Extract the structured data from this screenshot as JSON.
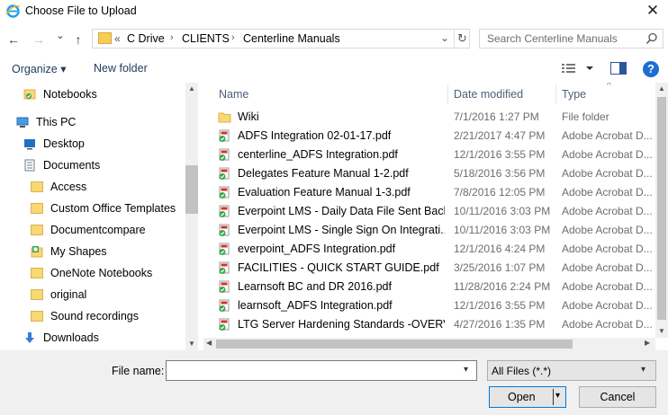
{
  "window": {
    "title": "Choose File to Upload",
    "close_glyph": "✕"
  },
  "navigation": {
    "back_glyph": "←",
    "forward_glyph": "→",
    "recent_glyph": "⌄",
    "up_glyph": "↑"
  },
  "address": {
    "chevrons": "«",
    "crumbs": [
      "C Drive",
      "CLIENTS",
      "Centerline Manuals"
    ],
    "separator": "›",
    "dropdown_glyph": "⌄",
    "refresh_glyph": "↻"
  },
  "search": {
    "placeholder": "Search Centerline Manuals"
  },
  "toolbar": {
    "organize_label": "Organize ▾",
    "new_folder_label": "New folder",
    "help_glyph": "?"
  },
  "nav_pane": {
    "items": [
      {
        "label": "Notebooks",
        "icon": "notebook-icon"
      },
      {
        "label": "This PC",
        "icon": "computer-icon"
      },
      {
        "label": "Desktop",
        "icon": "desktop-icon"
      },
      {
        "label": "Documents",
        "icon": "documents-icon"
      },
      {
        "label": "Access",
        "icon": "folder-icon"
      },
      {
        "label": "Custom Office Templates",
        "icon": "folder-icon"
      },
      {
        "label": "Documentcompare",
        "icon": "folder-icon"
      },
      {
        "label": "My Shapes",
        "icon": "shapes-folder-icon"
      },
      {
        "label": "OneNote Notebooks",
        "icon": "folder-icon"
      },
      {
        "label": "original",
        "icon": "folder-icon"
      },
      {
        "label": "Sound recordings",
        "icon": "folder-icon"
      },
      {
        "label": "Downloads",
        "icon": "downloads-icon"
      }
    ]
  },
  "file_list": {
    "columns": [
      "Name",
      "Date modified",
      "Type"
    ],
    "sort_glyph": "^",
    "rows": [
      {
        "name": "Wiki",
        "date": "7/1/2016 1:27 PM",
        "type": "File folder",
        "icon": "folder-icon"
      },
      {
        "name": "ADFS Integration 02-01-17.pdf",
        "date": "2/21/2017 4:47 PM",
        "type": "Adobe Acrobat D...",
        "icon": "pdf-icon"
      },
      {
        "name": "centerline_ADFS Integration.pdf",
        "date": "12/1/2016 3:55 PM",
        "type": "Adobe Acrobat D...",
        "icon": "pdf-icon"
      },
      {
        "name": "Delegates Feature Manual 1-2.pdf",
        "date": "5/18/2016 3:56 PM",
        "type": "Adobe Acrobat D...",
        "icon": "pdf-icon"
      },
      {
        "name": "Evaluation Feature Manual 1-3.pdf",
        "date": "7/8/2016 12:05 PM",
        "type": "Adobe Acrobat D...",
        "icon": "pdf-icon"
      },
      {
        "name": "Everpoint LMS - Daily Data File Sent Back...",
        "date": "10/11/2016 3:03 PM",
        "type": "Adobe Acrobat D...",
        "icon": "pdf-icon"
      },
      {
        "name": "Everpoint LMS - Single Sign On Integrati...",
        "date": "10/11/2016 3:03 PM",
        "type": "Adobe Acrobat D...",
        "icon": "pdf-icon"
      },
      {
        "name": "everpoint_ADFS Integration.pdf",
        "date": "12/1/2016 4:24 PM",
        "type": "Adobe Acrobat D...",
        "icon": "pdf-icon"
      },
      {
        "name": "FACILITIES - QUICK START GUIDE.pdf",
        "date": "3/25/2016 1:07 PM",
        "type": "Adobe Acrobat D...",
        "icon": "pdf-icon"
      },
      {
        "name": "Learnsoft BC and DR 2016.pdf",
        "date": "11/28/2016 2:24 PM",
        "type": "Adobe Acrobat D...",
        "icon": "pdf-icon"
      },
      {
        "name": "learnsoft_ADFS Integration.pdf",
        "date": "12/1/2016 3:55 PM",
        "type": "Adobe Acrobat D...",
        "icon": "pdf-icon"
      },
      {
        "name": "LTG Server Hardening Standards -OVERVI...",
        "date": "4/27/2016 1:35 PM",
        "type": "Adobe Acrobat D...",
        "icon": "pdf-icon"
      }
    ]
  },
  "footer": {
    "file_name_label": "File name:",
    "file_name_value": "",
    "filter_value": "All Files (*.*)",
    "open_label": "Open",
    "cancel_label": "Cancel",
    "dropdown_glyph": "▾"
  },
  "colors": {
    "accent": "#0078d7",
    "folder": "#f8d775",
    "link": "#1e395b",
    "pdf": "#d9302c",
    "check": "#3aa54a"
  }
}
